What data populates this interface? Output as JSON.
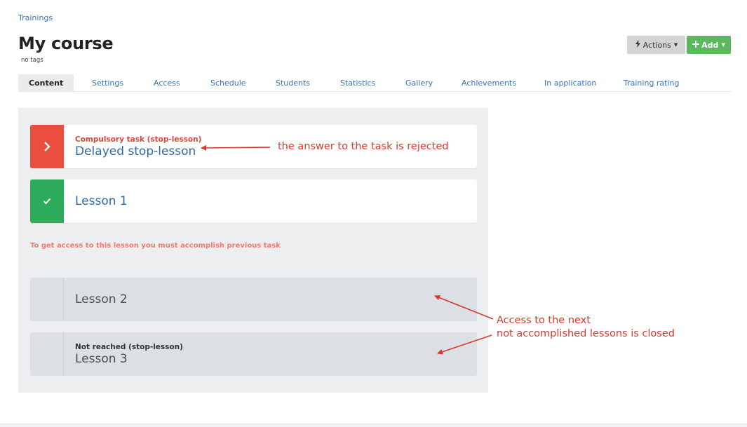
{
  "breadcrumb": "Trainings",
  "page_title": "My course",
  "tags_label": "no tags",
  "header": {
    "actions_label": "Actions",
    "add_label": "Add"
  },
  "tabs": [
    {
      "label": "Content",
      "active": true
    },
    {
      "label": "Settings"
    },
    {
      "label": "Access"
    },
    {
      "label": "Schedule"
    },
    {
      "label": "Students"
    },
    {
      "label": "Statistics"
    },
    {
      "label": "Gallery"
    },
    {
      "label": "Achievements"
    },
    {
      "label": "In application"
    },
    {
      "label": "Training rating"
    }
  ],
  "lessons": [
    {
      "subtitle": "Compulsory task (stop-lesson)",
      "title": "Delayed stop-lesson",
      "state": "rejected",
      "icon": "chevron-right-icon"
    },
    {
      "subtitle": "",
      "title": "Lesson 1",
      "state": "completed",
      "icon": "check-icon"
    },
    {
      "subtitle": "",
      "title": "Lesson 2",
      "state": "locked"
    },
    {
      "subtitle": "Not reached (stop-lesson)",
      "title": "Lesson 3",
      "state": "locked"
    }
  ],
  "access_warning": "To get access to this lesson you must accomplish previous task",
  "annotations": {
    "rejected_note": "the answer to the task is rejected",
    "closed_note_line1": "Access to the next",
    "closed_note_line2": "not accomplished lessons is closed"
  },
  "colors": {
    "accent_red": "#e94e3f",
    "accent_green": "#2dab5a",
    "link_blue": "#2f6aa8",
    "annotation_red": "#d9382d"
  }
}
